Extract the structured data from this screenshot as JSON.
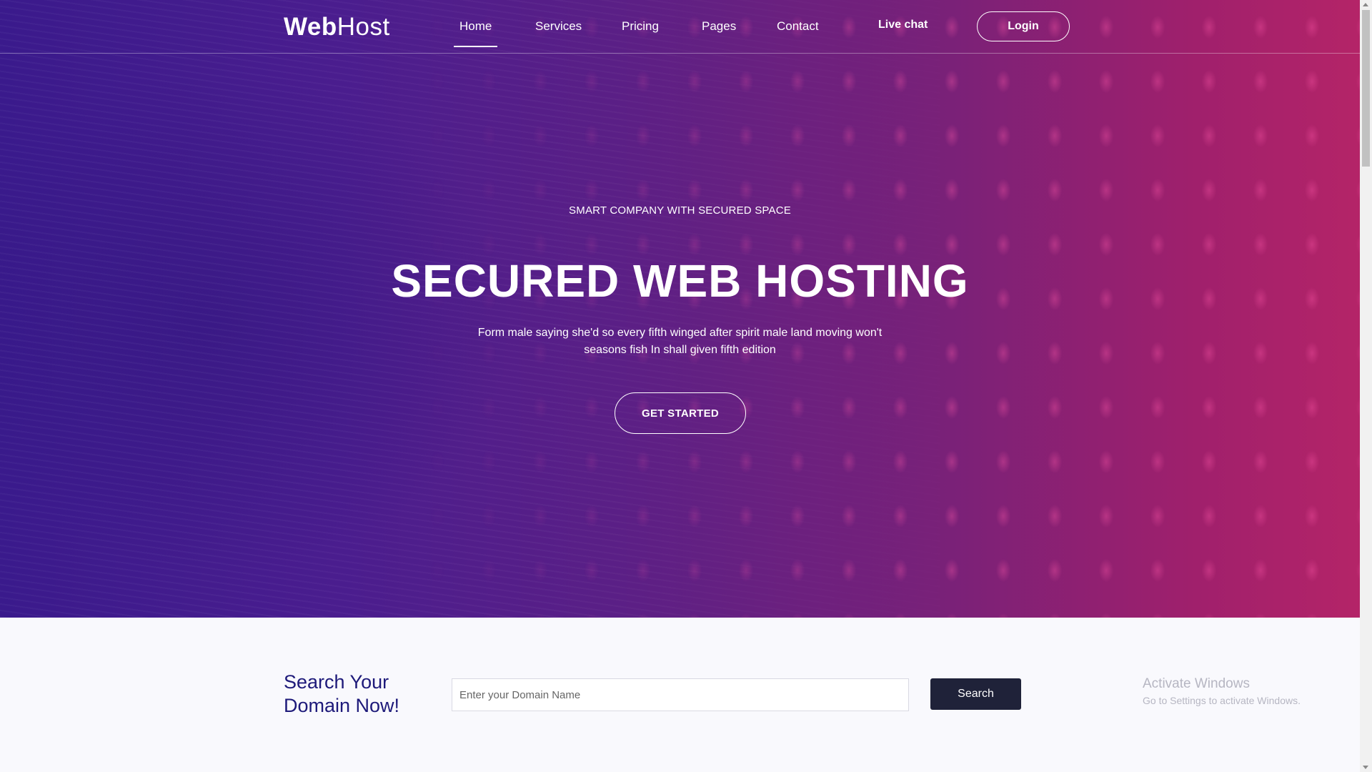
{
  "header": {
    "logo_bold": "Web",
    "logo_light": "Host",
    "nav": [
      {
        "label": "Home",
        "active": true
      },
      {
        "label": "Services",
        "active": false
      },
      {
        "label": "Pricing",
        "active": false
      },
      {
        "label": "Pages",
        "active": false
      },
      {
        "label": "Contact",
        "active": false
      }
    ],
    "live_chat": "Live chat",
    "login": "Login"
  },
  "hero": {
    "subtitle": "SMART COMPANY WITH SECURED SPACE",
    "title": "SECURED WEB HOSTING",
    "description": "Form male saying she'd so every fifth winged after spirit male land moving won't seasons fish In shall given fifth edition",
    "cta": "GET STARTED"
  },
  "search": {
    "heading_line1": "Search Your",
    "heading_line2": "Domain Now!",
    "placeholder": "Enter your Domain Name",
    "button": "Search"
  },
  "watermark": {
    "line1": "Activate Windows",
    "line2": "Go to Settings to activate Windows."
  },
  "colors": {
    "hero_start": "#3a1a8c",
    "hero_end": "#b42468",
    "heading_blue": "#1e1a7a",
    "search_button": "#1f2239"
  }
}
